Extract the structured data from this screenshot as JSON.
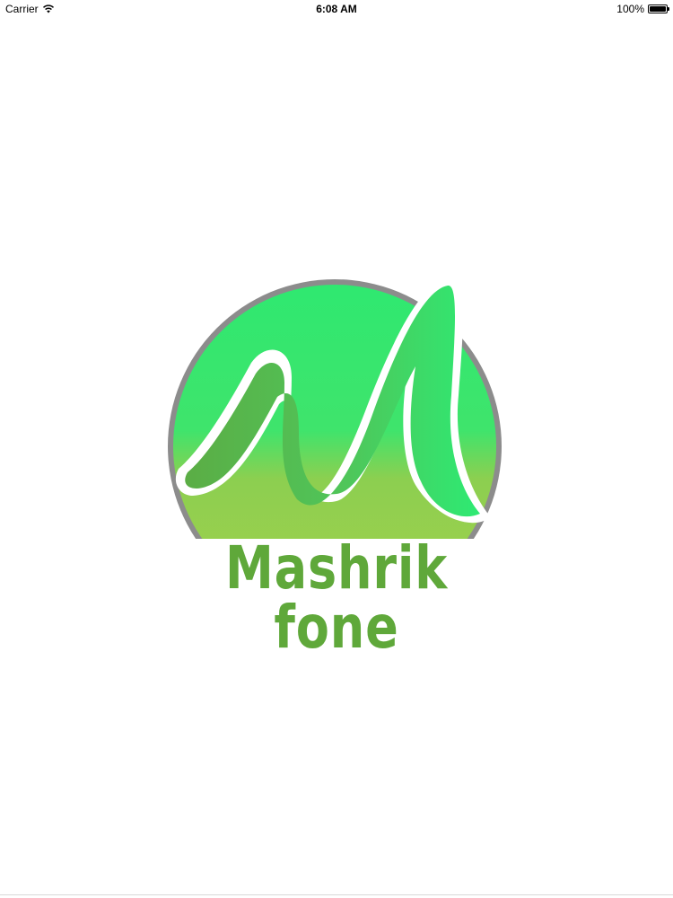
{
  "status_bar": {
    "carrier": "Carrier",
    "time": "6:08 AM",
    "battery_percent": "100%",
    "battery_level": 1.0,
    "wifi_icon": "wifi-icon",
    "battery_icon": "battery-icon"
  },
  "splash": {
    "logo_text": "Mashrik fone",
    "colors": {
      "ring": "#8c8c8c",
      "top_green": "#2fe870",
      "bottom_green": "#9ed04e",
      "wordmark": "#5fa83a",
      "m_dark": "#5cb046",
      "m_light": "#35e874"
    }
  }
}
